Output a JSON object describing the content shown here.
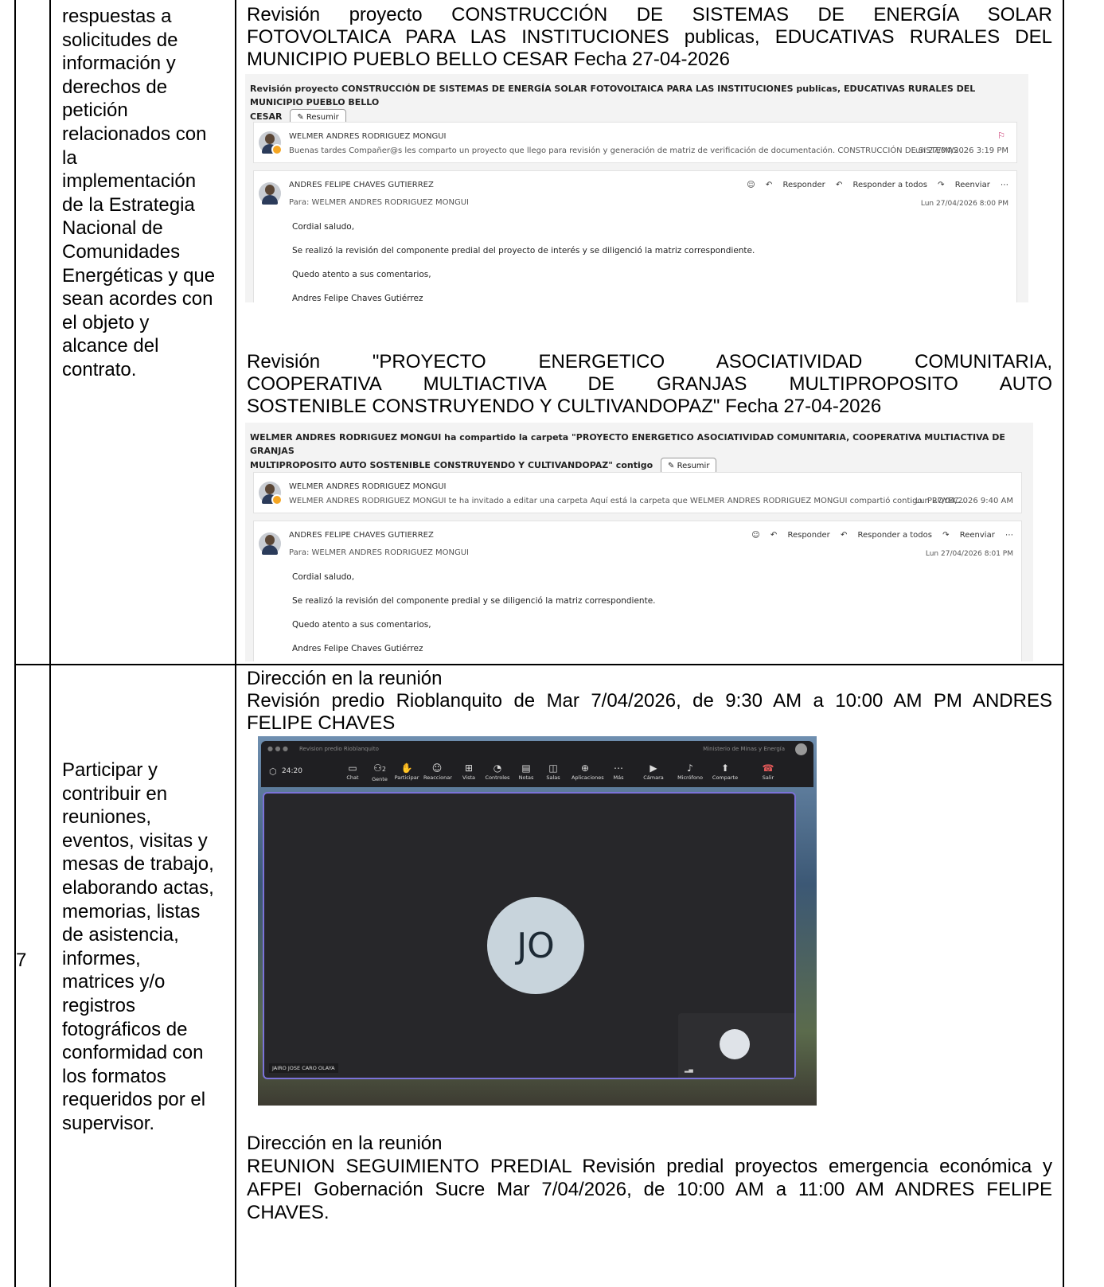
{
  "row_top": {
    "description_words": [
      "respuestas a",
      "solicitudes de",
      "información y",
      "derechos de",
      "petición",
      "relacionados con",
      "la",
      "implementación",
      "de la Estrategia",
      "Nacional de",
      "Comunidades",
      "Energéticas y que",
      "sean acordes con",
      "el objeto y",
      "alcance del",
      "contrato."
    ],
    "evidence_1": {
      "title_lines": [
        "Revisión proyecto CONSTRUCCIÓN DE SISTEMAS DE ENERGÍA SOLAR",
        "FOTOVOLTAICA PARA LAS INSTITUCIONES publicas, EDUCATIVAS RURALES DEL",
        "MUNICIPIO PUEBLO BELLO CESAR Fecha 27-04-2026"
      ],
      "mail": {
        "subject_1": "Revisión proyecto CONSTRUCCIÓN DE SISTEMAS DE ENERGÍA SOLAR FOTOVOLTAICA PARA LAS INSTITUCIONES publicas, EDUCATIVAS RURALES DEL MUNICIPIO PUEBLO BELLO",
        "subject_2": "CESAR",
        "summary_btn": "Resumir",
        "msg1_sender": "WELMER ANDRES RODRIGUEZ MONGUI",
        "msg1_preview": "Buenas tardes Compañer@s les comparto un proyecto que llego para revisión y generación de matriz de verificación de documentación.  CONSTRUCCIÓN DE SISTEMAS ...",
        "msg1_date": "Lun 27/04/2026 3:19 PM",
        "msg2_sender": "ANDRES FELIPE CHAVES GUTIERREZ",
        "msg2_to": "Para:  WELMER ANDRES RODRIGUEZ MONGUI",
        "msg2_date": "Lun 27/04/2026 8:00 PM",
        "actions": [
          "Responder",
          "Responder a todos",
          "Reenviar"
        ],
        "body": [
          "Cordial saludo,",
          "Se realizó la revisión del componente predial del proyecto de interés y se diligenció la matriz correspondiente.",
          "Quedo atento a sus comentarios,",
          "Andres Felipe Chaves Gutiérrez"
        ]
      }
    },
    "evidence_2": {
      "title_lines": [
        "Revisión \"PROYECTO ENERGETICO ASOCIATIVIDAD COMUNITARIA,",
        "COOPERATIVA MULTIACTIVA DE GRANJAS MULTIPROPOSITO AUTO",
        "SOSTENIBLE CONSTRUYENDO Y CULTIVANDOPAZ\" Fecha 27-04-2026"
      ],
      "mail": {
        "subject_1": "WELMER ANDRES RODRIGUEZ MONGUI ha compartido la carpeta \"PROYECTO ENERGETICO ASOCIATIVIDAD COMUNITARIA, COOPERATIVA  MULTIACTIVA DE GRANJAS",
        "subject_2": "MULTIPROPOSITO AUTO  SOSTENIBLE CONSTRUYENDO Y CULTIVANDOPAZ\" contigo",
        "summary_btn": "Resumir",
        "msg1_sender": "WELMER ANDRES RODRIGUEZ MONGUI",
        "msg1_preview": "WELMER ANDRES RODRIGUEZ MONGUI te ha invitado a editar una carpeta Aquí está la carpeta que WELMER ANDRES RODRIGUEZ MONGUI compartió contigo. PROYEC...",
        "msg1_date": "Lun 27/04/2026 9:40 AM",
        "msg2_sender": "ANDRES FELIPE CHAVES GUTIERREZ",
        "msg2_to": "Para:  WELMER ANDRES RODRIGUEZ MONGUI",
        "msg2_date": "Lun 27/04/2026 8:01 PM",
        "actions": [
          "Responder",
          "Responder a todos",
          "Reenviar"
        ],
        "body": [
          "Cordial saludo,",
          "Se realizó la revisión del componente predial y se diligenció la matriz correspondiente.",
          "Quedo atento a sus comentarios,",
          "Andres Felipe Chaves Gutiérrez"
        ]
      }
    }
  },
  "row_7": {
    "number": "7",
    "description_words": [
      "Participar y",
      "contribuir en",
      "reuniones,",
      "eventos, visitas y",
      "mesas de trabajo,",
      "elaborando actas,",
      "memorias, listas",
      "de asistencia,",
      "informes,",
      "matrices y/o",
      "registros",
      "fotográficos de",
      "conformidad con",
      "los formatos",
      "requeridos por el",
      "supervisor."
    ],
    "meeting_1": {
      "label": "Dirección en la reunión",
      "text_line1": "Revisión predio Rioblanquito de Mar 7/04/2026, de 9:30 AM a 10:00 AM  PM ANDRES",
      "text_line2": "FELIPE CHAVES",
      "teams": {
        "window_title": "Revision predio Rioblanquito",
        "org": "Ministerio de Minas y Energía",
        "timer": "24:20",
        "toolbar": [
          "Chat",
          "Gente",
          "Participar",
          "Reaccionar",
          "Vista",
          "Controles",
          "Notas",
          "Salas",
          "Aplicaciones",
          "Más"
        ],
        "toolbar_right": [
          "Cámara",
          "Micrófono",
          "Comparte",
          "Salir"
        ],
        "participant_count": "2",
        "avatar_initials": "JO",
        "participant_name": "JAIRO JOSE CARO OLAYA"
      }
    },
    "meeting_2": {
      "label": "Dirección en  la reunión",
      "text": "REUNION SEGUIMIENTO PREDIAL  Revisión predial proyectos emergencia económica y AFPEI Gobernación Sucre Mar 7/04/2026, de 10:00 AM a 11:00 AM ANDRES FELIPE CHAVES."
    }
  }
}
